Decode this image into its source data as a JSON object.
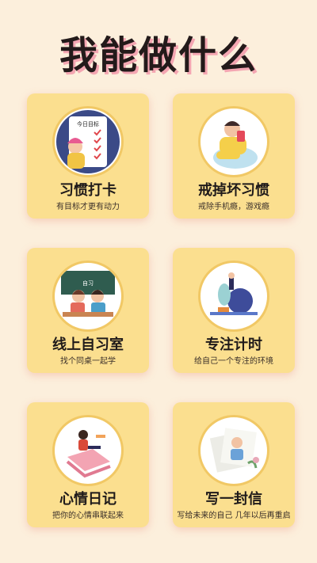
{
  "page_title": "我能做什么",
  "cards": [
    {
      "name": "习惯打卡",
      "desc": "有目标才更有动力",
      "badge_text": "今日目标"
    },
    {
      "name": "戒掉坏习惯",
      "desc": "戒除手机瘾，游戏瘾"
    },
    {
      "name": "线上自习室",
      "desc": "找个同桌一起学",
      "badge_text": "自习"
    },
    {
      "name": "专注计时",
      "desc": "给自己一个专注的环境"
    },
    {
      "name": "心情日记",
      "desc": "把你的心情串联起来"
    },
    {
      "name": "写一封信",
      "desc": "写给未来的自己 几年以后再重启"
    }
  ],
  "colors": {
    "background": "#fcefdc",
    "card": "#fbdf8f",
    "title_shadow": "#f4a6b2"
  }
}
